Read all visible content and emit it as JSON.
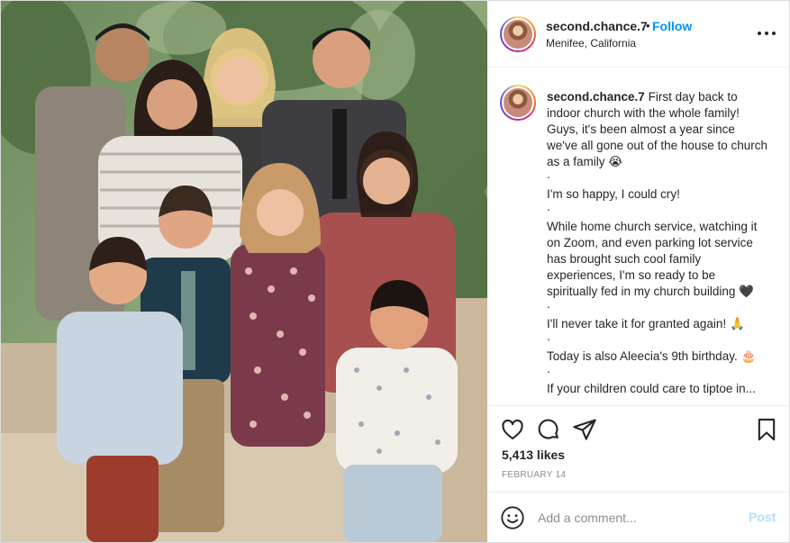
{
  "post": {
    "image_alt": "Family photo of nine people posing outdoors",
    "author": {
      "username": "second.chance.7",
      "location": "Menifee, California",
      "follow_label": "Follow",
      "separator": "•"
    },
    "caption": {
      "username": "second.chance.7",
      "lines": [
        "First day back to indoor church with the whole family! Guys, it's been almost a year since we've all gone out of the house to church as a family 😭",
        ".",
        "I'm so happy, I could cry!",
        ".",
        "While home church service, watching it on Zoom, and even parking lot service has brought such cool family experiences, I'm so ready to be spiritually fed in my church building 🖤",
        ".",
        "I'll never take it for granted again! 🙏",
        ".",
        "Today is also Aleecia's 9th birthday. 🎂",
        ".",
        "If your children could care to tiptoe in..."
      ]
    },
    "likes_text": "5,413 likes",
    "date_text": "February 14",
    "comment_placeholder": "Add a comment...",
    "post_label": "Post",
    "icons": {
      "more": "more-horizontal-icon",
      "like": "heart-icon",
      "comment": "comment-bubble-icon",
      "share": "paper-plane-icon",
      "save": "bookmark-icon",
      "emoji": "smiley-icon"
    },
    "colors": {
      "link": "#0095f6",
      "text": "#262626",
      "muted": "#8e8e8e",
      "post_disabled": "#b2dffc",
      "border": "#dbdbdb"
    }
  }
}
